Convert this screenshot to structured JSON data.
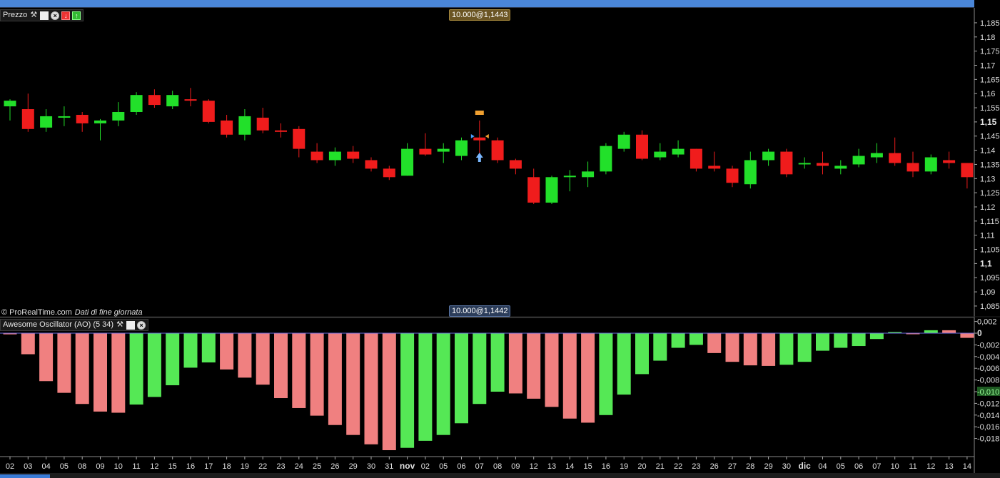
{
  "price_pane": {
    "title": "Prezzo",
    "tag_top": "10.000@1,1443",
    "tag_bottom": "10.000@1,1442",
    "copyright": "© ProRealTime.com",
    "data_note": "Dati di fine giornata"
  },
  "oscillator_pane": {
    "title": "Awesome Oscillator (AO) (5 34)"
  },
  "colors": {
    "background": "#000000",
    "candle_up": "#22e02a",
    "candle_down": "#f01c1c",
    "ao_up": "#55e855",
    "ao_down": "#f08080",
    "axis_text": "#e0e0e0",
    "grid": "#2a2a2a"
  },
  "icons": [
    "wrench-icon",
    "window-icon",
    "close-icon",
    "remove-icon",
    "add-icon"
  ],
  "chart_data": [
    {
      "type": "candlestick",
      "ylim": [
        1.08,
        1.187
      ],
      "y_ticks": [
        "1,185",
        "1,18",
        "1,175",
        "1,17",
        "1,165",
        "1,16",
        "1,155",
        "1,15",
        "1,145",
        "1,14",
        "1,135",
        "1,13",
        "1,125",
        "1,12",
        "1,115",
        "1,11",
        "1,105",
        "1,1",
        "1,095",
        "1,09",
        "1,085"
      ],
      "categories": [
        "02",
        "03",
        "04",
        "05",
        "08",
        "09",
        "10",
        "11",
        "12",
        "15",
        "16",
        "17",
        "18",
        "19",
        "22",
        "23",
        "24",
        "25",
        "26",
        "29",
        "30",
        "31",
        "nov",
        "02",
        "05",
        "06",
        "07",
        "08",
        "09",
        "12",
        "13",
        "14",
        "15",
        "16",
        "19",
        "20",
        "21",
        "22",
        "23",
        "26",
        "27",
        "28",
        "29",
        "30",
        "dic",
        "04",
        "05",
        "06",
        "07",
        "10",
        "11",
        "12",
        "13",
        "14"
      ],
      "ohlc": [
        [
          1.1555,
          1.158,
          1.1505,
          1.1575
        ],
        [
          1.1545,
          1.16,
          1.1465,
          1.1475
        ],
        [
          1.148,
          1.1545,
          1.1465,
          1.152
        ],
        [
          1.152,
          1.1555,
          1.1485,
          1.152
        ],
        [
          1.1525,
          1.1535,
          1.1465,
          1.1495
        ],
        [
          1.1495,
          1.151,
          1.1435,
          1.1505
        ],
        [
          1.1505,
          1.157,
          1.1485,
          1.1535
        ],
        [
          1.1535,
          1.1605,
          1.1525,
          1.1595
        ],
        [
          1.1595,
          1.1615,
          1.155,
          1.156
        ],
        [
          1.1555,
          1.161,
          1.1545,
          1.1595
        ],
        [
          1.158,
          1.162,
          1.1555,
          1.1575
        ],
        [
          1.1575,
          1.158,
          1.1495,
          1.15
        ],
        [
          1.1505,
          1.1525,
          1.1445,
          1.1455
        ],
        [
          1.1455,
          1.1545,
          1.1435,
          1.152
        ],
        [
          1.1515,
          1.155,
          1.146,
          1.147
        ],
        [
          1.147,
          1.1495,
          1.1445,
          1.1465
        ],
        [
          1.1475,
          1.1485,
          1.1375,
          1.1405
        ],
        [
          1.1395,
          1.1425,
          1.1355,
          1.1365
        ],
        [
          1.1365,
          1.141,
          1.1345,
          1.1395
        ],
        [
          1.1395,
          1.1415,
          1.1355,
          1.137
        ],
        [
          1.1365,
          1.1375,
          1.1325,
          1.1335
        ],
        [
          1.1335,
          1.1345,
          1.1295,
          1.1305
        ],
        [
          1.131,
          1.1425,
          1.131,
          1.1405
        ],
        [
          1.1405,
          1.146,
          1.138,
          1.1385
        ],
        [
          1.1395,
          1.1425,
          1.1355,
          1.1405
        ],
        [
          1.138,
          1.1445,
          1.1365,
          1.1435
        ],
        [
          1.1445,
          1.1505,
          1.1375,
          1.1435
        ],
        [
          1.1435,
          1.1445,
          1.1355,
          1.1365
        ],
        [
          1.1365,
          1.137,
          1.1315,
          1.1335
        ],
        [
          1.1305,
          1.1335,
          1.121,
          1.1215
        ],
        [
          1.1215,
          1.131,
          1.121,
          1.1305
        ],
        [
          1.131,
          1.133,
          1.1255,
          1.131
        ],
        [
          1.1305,
          1.136,
          1.127,
          1.1325
        ],
        [
          1.1325,
          1.1425,
          1.1315,
          1.1415
        ],
        [
          1.1405,
          1.1465,
          1.1395,
          1.1455
        ],
        [
          1.1455,
          1.147,
          1.1365,
          1.137
        ],
        [
          1.1375,
          1.1425,
          1.1365,
          1.1395
        ],
        [
          1.1385,
          1.1435,
          1.1375,
          1.1405
        ],
        [
          1.1405,
          1.1405,
          1.1325,
          1.1335
        ],
        [
          1.1345,
          1.1395,
          1.1325,
          1.1335
        ],
        [
          1.1335,
          1.1345,
          1.127,
          1.1285
        ],
        [
          1.128,
          1.1395,
          1.1265,
          1.1365
        ],
        [
          1.1365,
          1.1405,
          1.1345,
          1.1395
        ],
        [
          1.1395,
          1.1405,
          1.1305,
          1.1315
        ],
        [
          1.1355,
          1.1375,
          1.1335,
          1.1355
        ],
        [
          1.1355,
          1.1395,
          1.1315,
          1.1345
        ],
        [
          1.1335,
          1.1365,
          1.1315,
          1.1345
        ],
        [
          1.135,
          1.1405,
          1.134,
          1.138
        ],
        [
          1.1375,
          1.1425,
          1.1355,
          1.139
        ],
        [
          1.139,
          1.1445,
          1.1345,
          1.1355
        ],
        [
          1.1355,
          1.1395,
          1.1305,
          1.1325
        ],
        [
          1.1325,
          1.1385,
          1.1315,
          1.1375
        ],
        [
          1.1365,
          1.1395,
          1.1335,
          1.1355
        ],
        [
          1.1355,
          1.1355,
          1.1265,
          1.1305
        ]
      ]
    },
    {
      "type": "bar",
      "ylim": [
        -0.0188,
        0.0024
      ],
      "y_ticks": [
        "0,002",
        "0",
        "-0,002",
        "-0,004",
        "-0,006",
        "-0,008",
        "-0,010",
        "-0,012",
        "-0,014",
        "-0,016",
        "-0,018"
      ],
      "highlight_tick": "-0,010",
      "values": [
        -0.0002,
        -0.0036,
        -0.0082,
        -0.0102,
        -0.0121,
        -0.0134,
        -0.0136,
        -0.0122,
        -0.0109,
        -0.0089,
        -0.0059,
        -0.005,
        -0.0062,
        -0.0076,
        -0.0088,
        -0.0111,
        -0.0128,
        -0.0141,
        -0.0157,
        -0.0174,
        -0.019,
        -0.02,
        -0.0196,
        -0.0184,
        -0.0174,
        -0.0154,
        -0.0121,
        -0.01,
        -0.0103,
        -0.0112,
        -0.0126,
        -0.0146,
        -0.0153,
        -0.014,
        -0.0105,
        -0.007,
        -0.0047,
        -0.0025,
        -0.002,
        -0.0034,
        -0.0049,
        -0.0055,
        -0.0056,
        -0.0054,
        -0.0049,
        -0.003,
        -0.0025,
        -0.0022,
        -0.001,
        0.0002,
        -0.0001,
        0.0005,
        0.0005,
        -0.0008
      ],
      "direction": [
        "down",
        "down",
        "down",
        "down",
        "down",
        "down",
        "down",
        "up",
        "up",
        "up",
        "up",
        "up",
        "down",
        "down",
        "down",
        "down",
        "down",
        "down",
        "down",
        "down",
        "down",
        "down",
        "up",
        "up",
        "up",
        "up",
        "up",
        "up",
        "down",
        "down",
        "down",
        "down",
        "down",
        "up",
        "up",
        "up",
        "up",
        "up",
        "up",
        "down",
        "down",
        "down",
        "down",
        "up",
        "up",
        "up",
        "up",
        "up",
        "up",
        "up",
        "down",
        "up",
        "down",
        "down"
      ]
    }
  ]
}
